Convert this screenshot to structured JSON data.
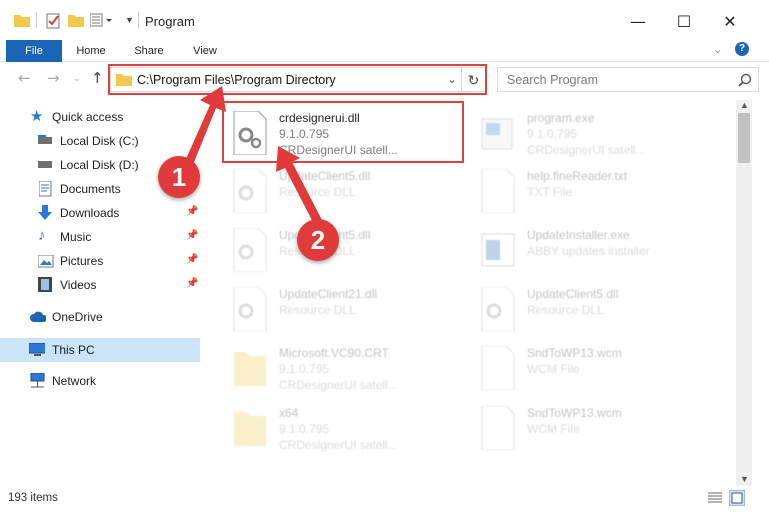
{
  "window": {
    "title": "Program",
    "minimize": "—",
    "maximize": "☐",
    "close": "✕"
  },
  "ribbon": {
    "tabs": [
      "File",
      "Home",
      "Share",
      "View"
    ]
  },
  "address": {
    "path": "C:\\Program Files\\Program Directory",
    "search_placeholder": "Search Program"
  },
  "sidebar": {
    "items": [
      {
        "label": "Quick access",
        "icon": "star-icon"
      },
      {
        "label": "Local Disk (C:)",
        "icon": "drive-icon"
      },
      {
        "label": "Local Disk (D:)",
        "icon": "drive-icon"
      },
      {
        "label": "Documents",
        "icon": "documents-icon"
      },
      {
        "label": "Downloads",
        "icon": "download-icon"
      },
      {
        "label": "Music",
        "icon": "music-icon"
      },
      {
        "label": "Pictures",
        "icon": "pictures-icon"
      },
      {
        "label": "Videos",
        "icon": "videos-icon"
      },
      {
        "label": "OneDrive",
        "icon": "cloud-icon"
      },
      {
        "label": "This PC",
        "icon": "computer-icon"
      },
      {
        "label": "Network",
        "icon": "network-icon"
      }
    ]
  },
  "files": [
    {
      "name": "crdesignerui.dll",
      "line2": "9.1.0.795",
      "line3": "CRDesignerUI satell...",
      "icon": "dll-gear-icon"
    },
    {
      "name": "program.exe",
      "line2": "9.1.0.795",
      "line3": "CRDesignerUI satell...",
      "icon": "exe-icon"
    },
    {
      "name": "UpdateClient5.dll",
      "line2": "Resource DLL",
      "line3": "",
      "icon": "dll-gear-icon"
    },
    {
      "name": "help.fineReader.txt",
      "line2": "TXT File",
      "line3": "",
      "icon": "text-file-icon"
    },
    {
      "name": "UpdateClient5.dll",
      "line2": "Resource DLL",
      "line3": "",
      "icon": "dll-gear-icon"
    },
    {
      "name": "UpdateInstaller.exe",
      "line2": "ABBY updates installer",
      "line3": "",
      "icon": "installer-icon"
    },
    {
      "name": "UpdateClient21.dll",
      "line2": "Resource DLL",
      "line3": "",
      "icon": "dll-gear-icon"
    },
    {
      "name": "UpdateClient5.dll",
      "line2": "Resource DLL",
      "line3": "",
      "icon": "dll-gear-icon"
    },
    {
      "name": "Microsoft.VC90.CRT",
      "line2": "9.1.0.795",
      "line3": "CRDesignerUI satell...",
      "icon": "folder-icon"
    },
    {
      "name": "SndToWP13.wcm",
      "line2": "WCM File",
      "line3": "",
      "icon": "blank-file-icon"
    },
    {
      "name": "x64",
      "line2": "9.1.0.795",
      "line3": "CRDesignerUI satell...",
      "icon": "folder-icon"
    },
    {
      "name": "SndToWP13.wcm",
      "line2": "WCM File",
      "line3": "",
      "icon": "blank-file-icon"
    }
  ],
  "status": {
    "item_count": "193 items"
  },
  "callouts": [
    "1",
    "2"
  ],
  "colors": {
    "accent": "#1b65b6",
    "highlight": "#e2413f",
    "selection": "#cce4f7"
  }
}
